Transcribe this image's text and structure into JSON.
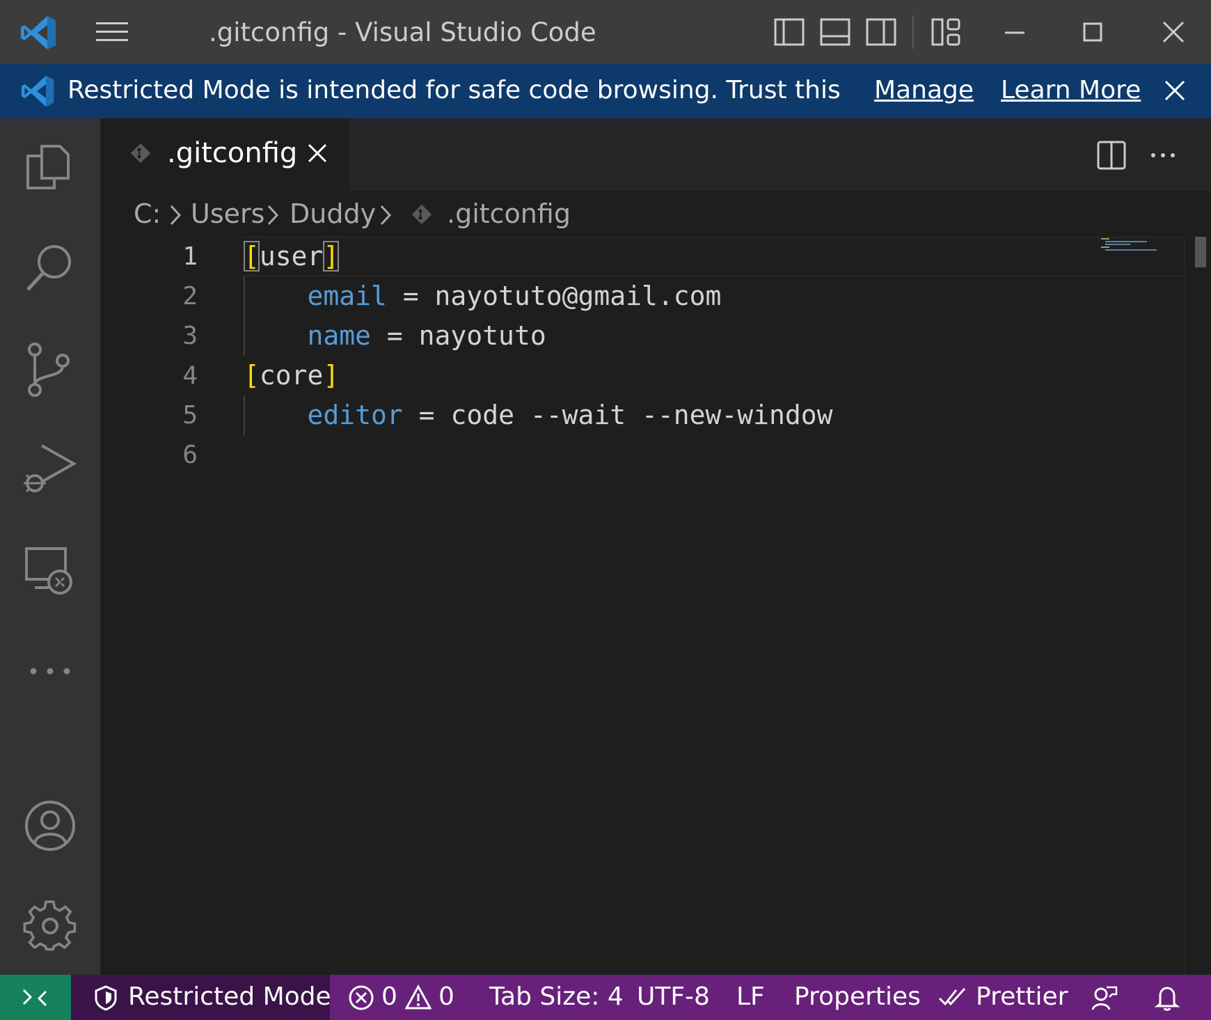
{
  "window": {
    "title": ".gitconfig - Visual Studio Code",
    "controls": [
      "minimize",
      "maximize",
      "close"
    ]
  },
  "banner": {
    "message": "Restricted Mode is intended for safe code browsing. Trust this windo...",
    "manage_label": "Manage",
    "learn_more_label": "Learn More"
  },
  "activity_bar": {
    "items": [
      "explorer-icon",
      "search-icon",
      "source-control-icon",
      "run-debug-icon",
      "remote-explorer-icon",
      "more-icon"
    ],
    "bottom_items": [
      "account-icon",
      "settings-gear-icon"
    ]
  },
  "tab": {
    "label": ".gitconfig"
  },
  "breadcrumb": {
    "items": [
      "C:",
      "Users",
      "Duddy",
      ".gitconfig"
    ]
  },
  "editor": {
    "lines": [
      {
        "number": "1",
        "open": "[",
        "text": "user",
        "close": "]"
      },
      {
        "number": "2",
        "indent": "    ",
        "key": "email",
        "sep": " = ",
        "value": "nayotuto@gmail.com"
      },
      {
        "number": "3",
        "indent": "    ",
        "key": "name",
        "sep": " = ",
        "value": "nayotuto"
      },
      {
        "number": "4",
        "open": "[",
        "text": "core",
        "close": "]"
      },
      {
        "number": "5",
        "indent": "    ",
        "key": "editor",
        "sep": " = ",
        "value": "code --wait --new-window"
      },
      {
        "number": "6"
      }
    ],
    "colors": {
      "key": "#569cd6",
      "bracket": "#ffd700",
      "text": "#d4d4d4"
    }
  },
  "status_bar": {
    "restricted_label": "Restricted Mode",
    "errors": "0",
    "warnings": "0",
    "tab_size": "Tab Size: 4",
    "encoding": "UTF-8",
    "eol": "LF",
    "language": "Properties",
    "formatter": "Prettier",
    "colors": {
      "background": "#68217a",
      "remote": "#16825d",
      "restricted": "#3c1348"
    }
  }
}
